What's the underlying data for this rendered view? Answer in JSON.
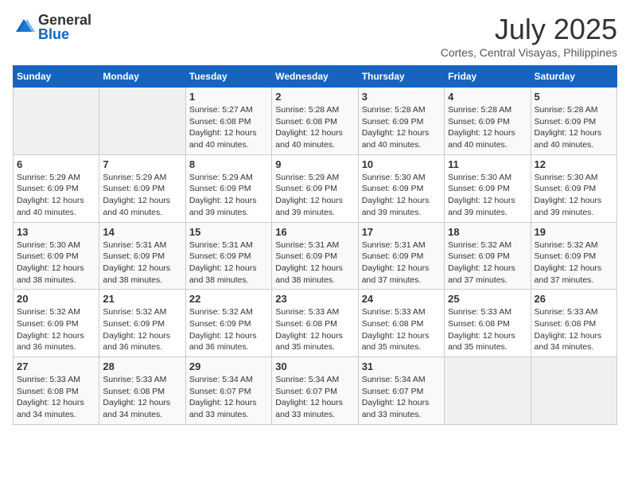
{
  "header": {
    "logo_general": "General",
    "logo_blue": "Blue",
    "month": "July 2025",
    "location": "Cortes, Central Visayas, Philippines"
  },
  "days_of_week": [
    "Sunday",
    "Monday",
    "Tuesday",
    "Wednesday",
    "Thursday",
    "Friday",
    "Saturday"
  ],
  "weeks": [
    [
      {
        "day": "",
        "info": ""
      },
      {
        "day": "",
        "info": ""
      },
      {
        "day": "1",
        "sunrise": "5:27 AM",
        "sunset": "6:08 PM",
        "daylight": "12 hours and 40 minutes."
      },
      {
        "day": "2",
        "sunrise": "5:28 AM",
        "sunset": "6:08 PM",
        "daylight": "12 hours and 40 minutes."
      },
      {
        "day": "3",
        "sunrise": "5:28 AM",
        "sunset": "6:09 PM",
        "daylight": "12 hours and 40 minutes."
      },
      {
        "day": "4",
        "sunrise": "5:28 AM",
        "sunset": "6:09 PM",
        "daylight": "12 hours and 40 minutes."
      },
      {
        "day": "5",
        "sunrise": "5:28 AM",
        "sunset": "6:09 PM",
        "daylight": "12 hours and 40 minutes."
      }
    ],
    [
      {
        "day": "6",
        "sunrise": "5:29 AM",
        "sunset": "6:09 PM",
        "daylight": "12 hours and 40 minutes."
      },
      {
        "day": "7",
        "sunrise": "5:29 AM",
        "sunset": "6:09 PM",
        "daylight": "12 hours and 40 minutes."
      },
      {
        "day": "8",
        "sunrise": "5:29 AM",
        "sunset": "6:09 PM",
        "daylight": "12 hours and 39 minutes."
      },
      {
        "day": "9",
        "sunrise": "5:29 AM",
        "sunset": "6:09 PM",
        "daylight": "12 hours and 39 minutes."
      },
      {
        "day": "10",
        "sunrise": "5:30 AM",
        "sunset": "6:09 PM",
        "daylight": "12 hours and 39 minutes."
      },
      {
        "day": "11",
        "sunrise": "5:30 AM",
        "sunset": "6:09 PM",
        "daylight": "12 hours and 39 minutes."
      },
      {
        "day": "12",
        "sunrise": "5:30 AM",
        "sunset": "6:09 PM",
        "daylight": "12 hours and 39 minutes."
      }
    ],
    [
      {
        "day": "13",
        "sunrise": "5:30 AM",
        "sunset": "6:09 PM",
        "daylight": "12 hours and 38 minutes."
      },
      {
        "day": "14",
        "sunrise": "5:31 AM",
        "sunset": "6:09 PM",
        "daylight": "12 hours and 38 minutes."
      },
      {
        "day": "15",
        "sunrise": "5:31 AM",
        "sunset": "6:09 PM",
        "daylight": "12 hours and 38 minutes."
      },
      {
        "day": "16",
        "sunrise": "5:31 AM",
        "sunset": "6:09 PM",
        "daylight": "12 hours and 38 minutes."
      },
      {
        "day": "17",
        "sunrise": "5:31 AM",
        "sunset": "6:09 PM",
        "daylight": "12 hours and 37 minutes."
      },
      {
        "day": "18",
        "sunrise": "5:32 AM",
        "sunset": "6:09 PM",
        "daylight": "12 hours and 37 minutes."
      },
      {
        "day": "19",
        "sunrise": "5:32 AM",
        "sunset": "6:09 PM",
        "daylight": "12 hours and 37 minutes."
      }
    ],
    [
      {
        "day": "20",
        "sunrise": "5:32 AM",
        "sunset": "6:09 PM",
        "daylight": "12 hours and 36 minutes."
      },
      {
        "day": "21",
        "sunrise": "5:32 AM",
        "sunset": "6:09 PM",
        "daylight": "12 hours and 36 minutes."
      },
      {
        "day": "22",
        "sunrise": "5:32 AM",
        "sunset": "6:09 PM",
        "daylight": "12 hours and 36 minutes."
      },
      {
        "day": "23",
        "sunrise": "5:33 AM",
        "sunset": "6:08 PM",
        "daylight": "12 hours and 35 minutes."
      },
      {
        "day": "24",
        "sunrise": "5:33 AM",
        "sunset": "6:08 PM",
        "daylight": "12 hours and 35 minutes."
      },
      {
        "day": "25",
        "sunrise": "5:33 AM",
        "sunset": "6:08 PM",
        "daylight": "12 hours and 35 minutes."
      },
      {
        "day": "26",
        "sunrise": "5:33 AM",
        "sunset": "6:08 PM",
        "daylight": "12 hours and 34 minutes."
      }
    ],
    [
      {
        "day": "27",
        "sunrise": "5:33 AM",
        "sunset": "6:08 PM",
        "daylight": "12 hours and 34 minutes."
      },
      {
        "day": "28",
        "sunrise": "5:33 AM",
        "sunset": "6:08 PM",
        "daylight": "12 hours and 34 minutes."
      },
      {
        "day": "29",
        "sunrise": "5:34 AM",
        "sunset": "6:07 PM",
        "daylight": "12 hours and 33 minutes."
      },
      {
        "day": "30",
        "sunrise": "5:34 AM",
        "sunset": "6:07 PM",
        "daylight": "12 hours and 33 minutes."
      },
      {
        "day": "31",
        "sunrise": "5:34 AM",
        "sunset": "6:07 PM",
        "daylight": "12 hours and 33 minutes."
      },
      {
        "day": "",
        "info": ""
      },
      {
        "day": "",
        "info": ""
      }
    ]
  ],
  "labels": {
    "sunrise_prefix": "Sunrise: ",
    "sunset_prefix": "Sunset: ",
    "daylight_prefix": "Daylight: "
  }
}
